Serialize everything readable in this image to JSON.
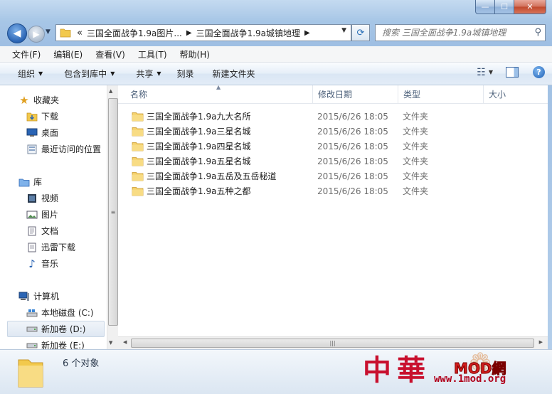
{
  "window": {
    "controls": {
      "minimize": "—",
      "maximize": "☐",
      "close": "✕"
    }
  },
  "nav": {
    "back_icon": "back-arrow-icon",
    "forward_icon": "forward-arrow-icon",
    "breadcrumb_overflow": "«",
    "breadcrumbs": [
      "三国全面战争1.9a图片...",
      "三国全面战争1.9a城镇地理"
    ],
    "search_placeholder": "搜索 三国全面战争1.9a城镇地理"
  },
  "menubar": {
    "items": [
      "文件(F)",
      "编辑(E)",
      "查看(V)",
      "工具(T)",
      "帮助(H)"
    ]
  },
  "toolbar": {
    "organize": "组织",
    "include_in_library": "包含到库中",
    "share": "共享",
    "burn": "刻录",
    "new_folder": "新建文件夹",
    "help": "?"
  },
  "sidebar": {
    "favorites": "收藏夹",
    "downloads": "下载",
    "desktop": "桌面",
    "recent": "最近访问的位置",
    "libraries": "库",
    "videos": "视频",
    "pictures": "图片",
    "documents": "文档",
    "thunder": "迅雷下载",
    "music": "音乐",
    "computer": "计算机",
    "local_disk_c": "本地磁盘 (C:)",
    "volume_d": "新加卷 (D:)",
    "volume_e": "新加卷 (E:)"
  },
  "columns": {
    "name": "名称",
    "modified": "修改日期",
    "type": "类型",
    "size": "大小"
  },
  "files": [
    {
      "name": "三国全面战争1.9a九大名所",
      "modified": "2015/6/26 18:05",
      "type": "文件夹"
    },
    {
      "name": "三国全面战争1.9a三星名城",
      "modified": "2015/6/26 18:05",
      "type": "文件夹"
    },
    {
      "name": "三国全面战争1.9a四星名城",
      "modified": "2015/6/26 18:05",
      "type": "文件夹"
    },
    {
      "name": "三国全面战争1.9a五星名城",
      "modified": "2015/6/26 18:05",
      "type": "文件夹"
    },
    {
      "name": "三国全面战争1.9a五岳及五岳秘道",
      "modified": "2015/6/26 18:05",
      "type": "文件夹"
    },
    {
      "name": "三国全面战争1.9a五种之都",
      "modified": "2015/6/26 18:05",
      "type": "文件夹"
    }
  ],
  "details": {
    "count": "6 个对象"
  },
  "watermark": {
    "chars": "中華",
    "mod": "MOD網",
    "url": "www.1mod.org"
  },
  "colors": {
    "accent": "#2a64b4",
    "folder": "#f2c94c",
    "watermark": "#c8102e"
  }
}
